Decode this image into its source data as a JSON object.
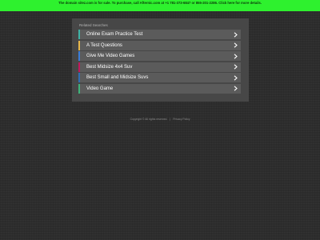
{
  "banner": {
    "text": "The domain sitez.com is for sale. To purchase, call Afternic.com at +1 781-373-6847 or 855-201-2286. Click here for more details.",
    "color": "#2ef12e"
  },
  "panel": {
    "title": "Related Searches"
  },
  "results": [
    {
      "label": "Online Exam Practice Test",
      "accent": "#3fb3a6",
      "icon": "chevron-right-icon"
    },
    {
      "label": "A Test Questions",
      "accent": "#e8b84a",
      "icon": "chevron-right-icon"
    },
    {
      "label": "Give Me Video Games",
      "accent": "#3b7dd8",
      "icon": "chevron-right-icon"
    },
    {
      "label": "Best Midsize 4x4 Suv",
      "accent": "#c2185b",
      "icon": "chevron-right-icon"
    },
    {
      "label": "Best Small and Midsize Suvs",
      "accent": "#2f6fb5",
      "icon": "chevron-right-icon"
    },
    {
      "label": "Video Game",
      "accent": "#3fb37a",
      "icon": "chevron-right-icon"
    }
  ],
  "footer": {
    "copyright": "Copyright ©  All rights reserved.",
    "separator": "|",
    "privacy": "Privacy Policy"
  },
  "colors": {
    "background": "#2d2d2d",
    "panel": "#474747",
    "item": "#5b5b5b"
  }
}
